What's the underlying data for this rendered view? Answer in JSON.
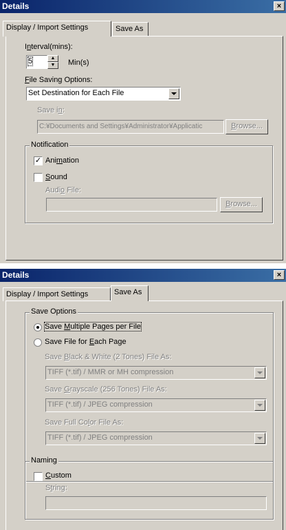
{
  "dialog1": {
    "title": "Details",
    "close": "×",
    "tabs": [
      "Display / Import Settings",
      "Save As"
    ],
    "interval": {
      "label_pre": "I",
      "label_u": "n",
      "label_post": "terval(mins):",
      "value": "5",
      "unit": "Min(s)"
    },
    "file_saving": {
      "label_u": "F",
      "label_rest": "ile Saving Options:",
      "selected": "Set Destination for Each File"
    },
    "save_in": {
      "label_pre": "Save i",
      "label_u": "n",
      "label_post": ":",
      "value": "C:¥Documents and Settings¥Administrator¥Applicatic",
      "browse_pre": "B",
      "browse_rest": "rowse..."
    },
    "notification": {
      "legend": "Notification",
      "animation": {
        "pre": "Ani",
        "u": "m",
        "post": "ation",
        "checked": "✓"
      },
      "sound": {
        "u": "S",
        "post": "ound"
      },
      "audio_file": {
        "pre": "Audi",
        "u": "o",
        "post": " File:",
        "value": ""
      },
      "browse_pre": "B",
      "browse_rest": "rowse..."
    }
  },
  "dialog2": {
    "title": "Details",
    "close": "×",
    "tabs": [
      "Display / Import Settings",
      "Save As"
    ],
    "save_options": {
      "legend": "Save Options",
      "multiple": {
        "pre": "Save ",
        "u": "M",
        "post": "ultiple Pages per File"
      },
      "each": {
        "pre": "Save File for ",
        "u": "E",
        "post": "ach Page"
      },
      "bw": {
        "pre": "Save ",
        "u": "B",
        "post": "lack & White (2 Tones) File As:",
        "value": "TIFF (*.tif) / MMR or MH compression"
      },
      "gray": {
        "pre": "Save ",
        "u": "G",
        "post": "rayscale (256 Tones) File As:",
        "value": "TIFF (*.tif) / JPEG compression"
      },
      "color": {
        "pre": "Save Full Co",
        "u": "l",
        "post": "or File As:",
        "value": "TIFF (*.tif) / JPEG compression"
      }
    },
    "naming": {
      "legend": "Naming",
      "custom": {
        "u": "C",
        "post": "ustom"
      },
      "string": {
        "pre": "S",
        "u": "t",
        "post": "ring:",
        "value": ""
      }
    }
  }
}
